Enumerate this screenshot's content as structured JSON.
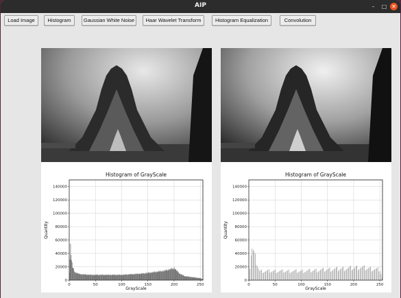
{
  "window": {
    "title": "AIP"
  },
  "toolbar": {
    "buttons": [
      {
        "label": "Load Image"
      },
      {
        "label": "Histogram"
      },
      {
        "label": "Gaussian White Noise"
      },
      {
        "label": "Haar Wavelet Transform"
      },
      {
        "label": "Histogram Equalization"
      },
      {
        "label": "Convolution"
      }
    ]
  },
  "chart_data": [
    {
      "type": "bar",
      "title": "Histogram of GrayScale",
      "xlabel": "GrayScale",
      "ylabel": "Quantity",
      "xlim": [
        0,
        255
      ],
      "ylim": [
        0,
        150000
      ],
      "xticks": [
        "0",
        "50",
        "100",
        "150",
        "200",
        "250"
      ],
      "yticks": [
        "0",
        "20000",
        "40000",
        "60000",
        "80000",
        "100000",
        "120000",
        "140000"
      ],
      "grid": true,
      "series": [
        {
          "x": [
            0,
            2,
            4,
            6,
            10,
            20,
            40,
            60,
            80,
            100,
            120,
            140,
            160,
            180,
            190,
            200,
            205,
            210,
            220,
            240,
            250,
            255
          ],
          "values": [
            12000,
            52000,
            30000,
            20000,
            12000,
            9000,
            8000,
            8000,
            8000,
            8000,
            9000,
            10000,
            12000,
            14000,
            16000,
            18000,
            14000,
            10000,
            6000,
            4000,
            3000,
            1000
          ]
        }
      ]
    },
    {
      "type": "bar",
      "title": "Histogram of GrayScale",
      "xlabel": "GrayScale",
      "ylabel": "Quantity",
      "xlim": [
        0,
        255
      ],
      "ylim": [
        0,
        150000
      ],
      "xticks": [
        "0",
        "50",
        "100",
        "150",
        "200",
        "250"
      ],
      "yticks": [
        "0",
        "20000",
        "40000",
        "60000",
        "80000",
        "100000",
        "120000",
        "140000"
      ],
      "grid": true,
      "series": [
        {
          "x": [
            0,
            5,
            20,
            40,
            60,
            80,
            100,
            120,
            140,
            160,
            180,
            200,
            210,
            220,
            230,
            240,
            250,
            255
          ],
          "values": [
            0,
            52000,
            14000,
            14000,
            14000,
            14000,
            14000,
            15000,
            16000,
            17000,
            18000,
            19000,
            20000,
            19000,
            18000,
            17000,
            16000,
            0
          ]
        }
      ]
    }
  ]
}
